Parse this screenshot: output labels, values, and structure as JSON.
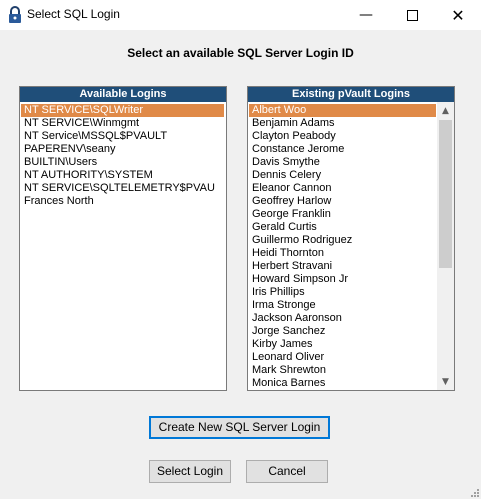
{
  "window": {
    "title": "Select SQL Login",
    "icon": "lock-icon",
    "controls": [
      "minimize-icon",
      "maximize-icon",
      "close-icon"
    ]
  },
  "heading": "Select an available SQL Server Login ID",
  "available_logins": {
    "header": "Available Logins",
    "items": [
      "NT SERVICE\\SQLWriter",
      "NT SERVICE\\Winmgmt",
      "NT Service\\MSSQL$PVAULT",
      "PAPERENV\\seany",
      "BUILTIN\\Users",
      "NT AUTHORITY\\SYSTEM",
      "NT SERVICE\\SQLTELEMETRY$PVAU",
      "Frances North"
    ],
    "selected_index": 0
  },
  "existing_logins": {
    "header": "Existing pVault Logins",
    "items": [
      "Albert Woo",
      "Benjamin Adams",
      "Clayton Peabody",
      "Constance Jerome",
      "Davis Smythe",
      "Dennis Celery",
      "Eleanor Cannon",
      "Geoffrey Harlow",
      "George Franklin",
      "Gerald Curtis",
      "Guillermo Rodriguez",
      "Heidi Thornton",
      "Herbert Stravani",
      "Howard Simpson Jr",
      "Iris Phillips",
      "Irma Stronge",
      "Jackson Aaronson",
      "Jorge Sanchez",
      "Kirby James",
      "Leonard Oliver",
      "Mark Shrewton",
      "Monica Barnes"
    ],
    "selected_index": 0
  },
  "buttons": {
    "create": "Create New SQL Server Login",
    "select": "Select Login",
    "cancel": "Cancel"
  },
  "colors": {
    "header_bg": "#1f4e79",
    "selection": "#e08a48",
    "focus_border": "#0078d7"
  }
}
